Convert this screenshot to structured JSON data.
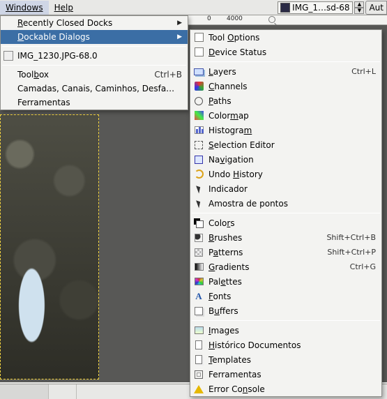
{
  "menubar": {
    "windows": "Windows",
    "help": "Help",
    "rightfile": "IMG_1…sd-68",
    "autobtn": "Aut"
  },
  "ruler": {
    "tick0": "0",
    "tick4000": "4000"
  },
  "menu1": {
    "recently_closed": "Recently Closed Docks",
    "dockable": "Dockable Dialogs",
    "doc1": "IMG_1230.JPG-68.0",
    "toolbox": "Toolbox",
    "toolbox_accel": "Ctrl+B",
    "camadas": "Camadas, Canais, Caminhos, Desfa…",
    "ferramentas": "Ferramentas"
  },
  "menu2": {
    "tool_options": "Tool Options",
    "device_status": "Device Status",
    "layers": "Layers",
    "layers_accel": "Ctrl+L",
    "channels": "Channels",
    "paths": "Paths",
    "colormap": "Colormap",
    "histogram": "Histogram",
    "selection_editor": "Selection Editor",
    "navigation": "Navigation",
    "undo_history": "Undo History",
    "indicador": "Indicador",
    "amostra": "Amostra de pontos",
    "colors": "Colors",
    "brushes": "Brushes",
    "brushes_accel": "Shift+Ctrl+B",
    "patterns": "Patterns",
    "patterns_accel": "Shift+Ctrl+P",
    "gradients": "Gradients",
    "gradients_accel": "Ctrl+G",
    "palettes": "Palettes",
    "fonts": "Fonts",
    "buffers": "Buffers",
    "images": "Images",
    "historico": "Histórico Documentos",
    "templates": "Templates",
    "ferramentas": "Ferramentas",
    "error_console": "Error Console"
  }
}
